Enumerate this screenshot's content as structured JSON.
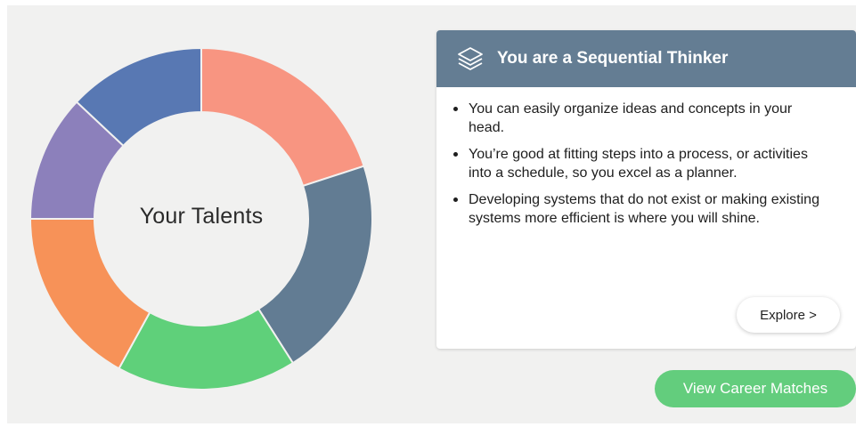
{
  "donut": {
    "center_label": "Your Talents",
    "segments": [
      {
        "color": "#f89581",
        "value": 20
      },
      {
        "color": "#627c93",
        "value": 21
      },
      {
        "color": "#5fd07a",
        "value": 17
      },
      {
        "color": "#f79258",
        "value": 17
      },
      {
        "color": "#8c80bb",
        "value": 12
      },
      {
        "color": "#5878b3",
        "value": 13
      }
    ]
  },
  "card": {
    "icon": "layers-icon",
    "title": "You are a Sequential Thinker",
    "bullets": [
      "You can easily organize ideas and concepts in your head.",
      "You’re good at fitting steps into a process, or activities into a schedule, so you excel as a planner.",
      "Developing systems that do not exist or making existing systems more efficient is where you will shine."
    ],
    "explore_label": "Explore >"
  },
  "actions": {
    "career_label": "View Career Matches"
  },
  "colors": {
    "header": "#647d93",
    "career_button": "#63cd7d",
    "panel_background": "#f1f1f0"
  }
}
